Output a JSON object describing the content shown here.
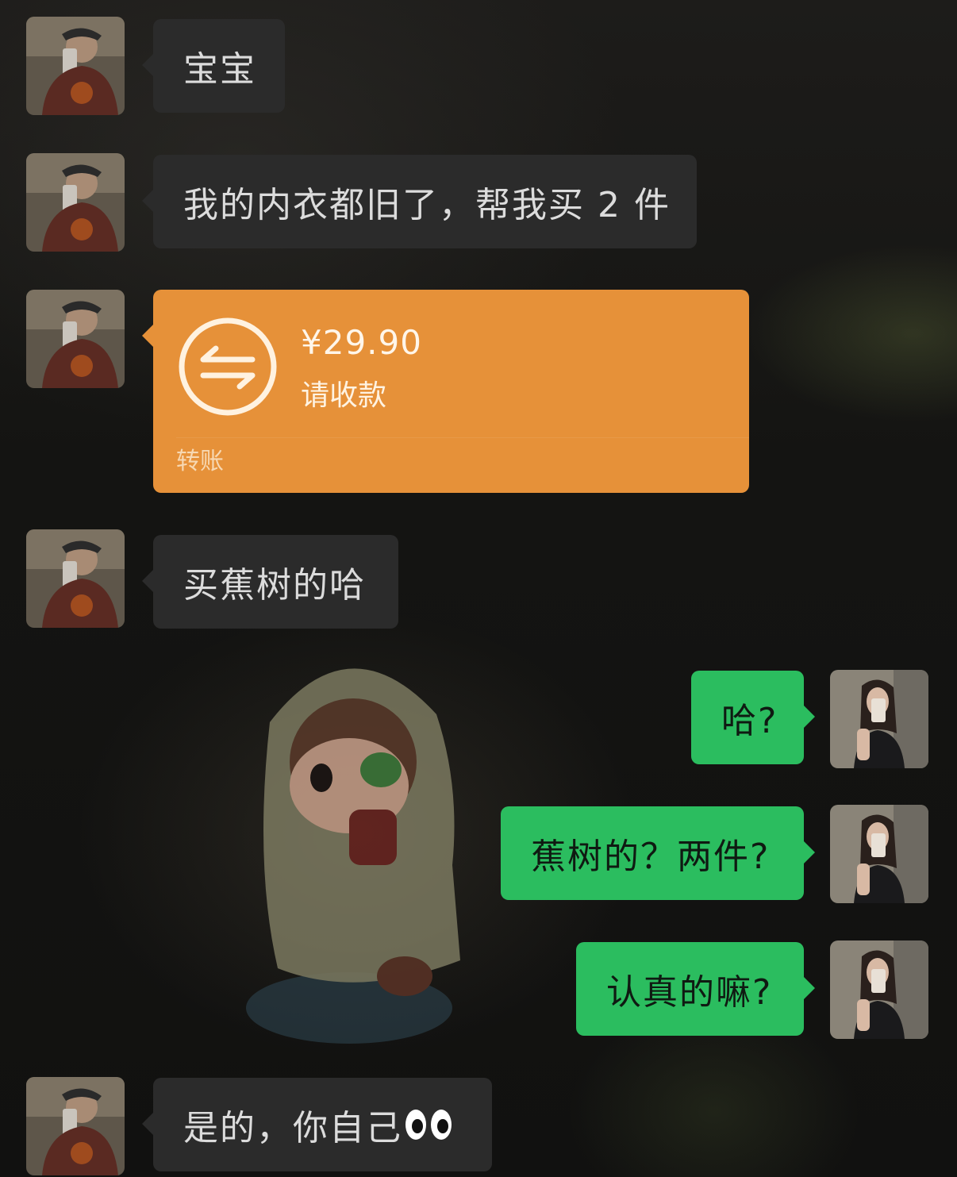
{
  "messages": [
    {
      "side": "in",
      "text": "宝宝"
    },
    {
      "side": "in",
      "text": "我的内衣都旧了，帮我买 2 件"
    },
    {
      "side": "in",
      "type": "transfer",
      "amount": "¥29.90",
      "note": "请收款",
      "label": "转账"
    },
    {
      "side": "in",
      "text": "买蕉树的哈"
    },
    {
      "side": "out",
      "text": "哈?"
    },
    {
      "side": "out",
      "text": "蕉树的？两件?"
    },
    {
      "side": "out",
      "text": "认真的嘛?"
    },
    {
      "side": "in",
      "text": "是的，你自己",
      "emoji": "eyes"
    }
  ],
  "colors": {
    "incoming_bubble": "#2b2b2b",
    "outgoing_bubble": "#2bbd5f",
    "transfer_card": "#e69139"
  }
}
